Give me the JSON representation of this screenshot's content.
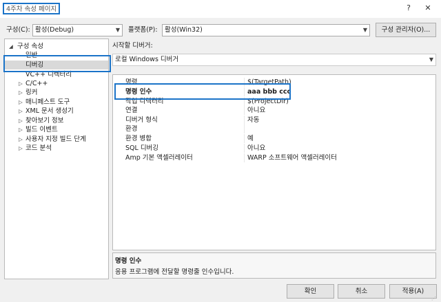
{
  "window": {
    "title": "4주차 속성 페이지",
    "help_glyph": "?",
    "close_glyph": "✕"
  },
  "toolbar": {
    "config_label": "구성(C):",
    "config_value": "활성(Debug)",
    "platform_label": "플랫폼(P):",
    "platform_value": "활성(Win32)",
    "config_manager_label": "구성 관리자(O)..."
  },
  "tree": {
    "items": [
      {
        "label": "구성 속성",
        "glyph": "◢"
      },
      {
        "label": "일반",
        "glyph": ""
      },
      {
        "label": "디버깅",
        "glyph": ""
      },
      {
        "label": "VC++ 디렉터리",
        "glyph": ""
      },
      {
        "label": "C/C++",
        "glyph": "▷"
      },
      {
        "label": "링커",
        "glyph": "▷"
      },
      {
        "label": "매니페스트 도구",
        "glyph": "▷"
      },
      {
        "label": "XML 문서 생성기",
        "glyph": "▷"
      },
      {
        "label": "찾아보기 정보",
        "glyph": "▷"
      },
      {
        "label": "빌드 이벤트",
        "glyph": "▷"
      },
      {
        "label": "사용자 지정 빌드 단계",
        "glyph": "▷"
      },
      {
        "label": "코드 분석",
        "glyph": "▷"
      }
    ]
  },
  "debugger": {
    "label": "시작할 디버거:",
    "value": "로컬 Windows 디버거"
  },
  "properties": [
    {
      "name": "명령",
      "value": "$(TargetPath)"
    },
    {
      "name": "명령 인수",
      "value": "aaa bbb ccc"
    },
    {
      "name": "작업 디렉터리",
      "value": "$(ProjectDir)"
    },
    {
      "name": "연결",
      "value": "아니요"
    },
    {
      "name": "디버거 형식",
      "value": "자동"
    },
    {
      "name": "환경",
      "value": ""
    },
    {
      "name": "환경 병합",
      "value": "예"
    },
    {
      "name": "SQL 디버깅",
      "value": "아니요"
    },
    {
      "name": "Amp 기본 액셀러레이터",
      "value": "WARP 소프트웨어 액셀러레이터"
    }
  ],
  "description": {
    "title": "명령 인수",
    "text": "응용 프로그램에 전달할 명령줄 인수입니다."
  },
  "footer": {
    "ok_label": "확인",
    "cancel_label": "취소",
    "apply_label": "적용(A)"
  },
  "colors": {
    "highlight": "#1a73c8",
    "selected_row": "#d9d9d9"
  }
}
